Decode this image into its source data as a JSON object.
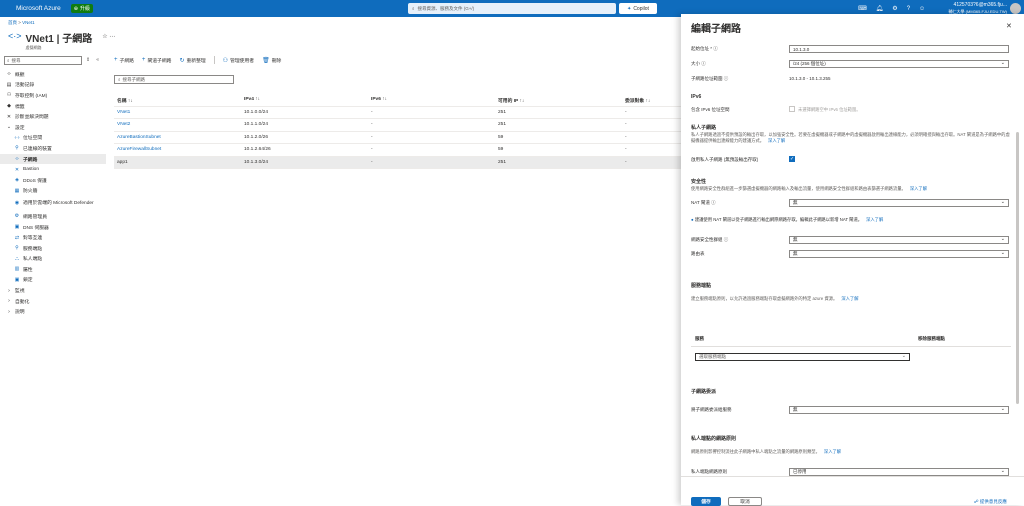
{
  "topbar": {
    "brand": "Microsoft Azure",
    "upgrade": "升級",
    "search_placeholder": "搜尋資源、服務及文件 (G+/)",
    "copilot": "Copilot",
    "account_name": "4125703?6@m365.fju...",
    "account_tenant": "輔仁大學 (MM365.FJU.EDU.TW)"
  },
  "breadcrumb": [
    "首頁",
    "VNet1"
  ],
  "page": {
    "title": "VNet1 | 子網路",
    "subtitle": "虛擬網路"
  },
  "sidebar": {
    "search_placeholder": "搜尋",
    "items": [
      {
        "label": "概觀",
        "icon": "overview-icon",
        "level": 0
      },
      {
        "label": "活動記錄",
        "icon": "activity-log-icon",
        "level": 0
      },
      {
        "label": "存取控制 (IAM)",
        "icon": "iam-icon",
        "level": 0
      },
      {
        "label": "標籤",
        "icon": "tag-icon",
        "level": 0
      },
      {
        "label": "診斷並解決問題",
        "icon": "diagnose-icon",
        "level": 0
      },
      {
        "label": "設定",
        "icon": "chevron-down-icon",
        "level": 0
      },
      {
        "label": "位址空間",
        "icon": "address-space-icon",
        "level": 1
      },
      {
        "label": "已連線的裝置",
        "icon": "devices-icon",
        "level": 1
      },
      {
        "label": "子網路",
        "icon": "subnet-icon",
        "level": 1,
        "active": true
      },
      {
        "label": "Bastion",
        "icon": "bastion-icon",
        "level": 1
      },
      {
        "label": "DDoS 保護",
        "icon": "ddos-icon",
        "level": 1
      },
      {
        "label": "防火牆",
        "icon": "firewall-icon",
        "level": 1
      },
      {
        "label": "適用於雲端的 Microsoft Defender",
        "icon": "defender-icon",
        "level": 1,
        "tall": true
      },
      {
        "label": "網路管理員",
        "icon": "network-manager-icon",
        "level": 1
      },
      {
        "label": "DNS 伺服器",
        "icon": "dns-icon",
        "level": 1
      },
      {
        "label": "對等互連",
        "icon": "peering-icon",
        "level": 1
      },
      {
        "label": "服務端點",
        "icon": "service-endpoint-icon",
        "level": 1
      },
      {
        "label": "私人端點",
        "icon": "private-endpoint-icon",
        "level": 1
      },
      {
        "label": "屬性",
        "icon": "properties-icon",
        "level": 1
      },
      {
        "label": "鎖定",
        "icon": "lock-icon",
        "level": 1
      },
      {
        "label": "監視",
        "icon": "chevron-right-icon",
        "level": 0
      },
      {
        "label": "自動化",
        "icon": "chevron-right-icon",
        "level": 0
      },
      {
        "label": "說明",
        "icon": "chevron-right-icon",
        "level": 0
      }
    ]
  },
  "toolbar": {
    "add_subnet": "子網路",
    "add_gateway_subnet": "閘道子網路",
    "refresh": "重新整理",
    "manage_users": "管理使用者",
    "delete": "刪除"
  },
  "filter_placeholder": "搜尋子網路",
  "table": {
    "headers": [
      "名稱 ↑↓",
      "IPv4 ↑↓",
      "IPv6 ↑↓",
      "可用的 IP ↑↓",
      "委派對象 ↑↓"
    ],
    "rows": [
      [
        "VNet1",
        "10.1.0.0/24",
        "-",
        "251",
        "-"
      ],
      [
        "VNet2",
        "10.1.1.0/24",
        "-",
        "251",
        "-"
      ],
      [
        "AzureBastionSubnet",
        "10.1.2.0/26",
        "-",
        "59",
        "-"
      ],
      [
        "AzureFirewallSubnet",
        "10.1.2.64/26",
        "-",
        "59",
        "-"
      ],
      [
        "app1",
        "10.1.3.0/24",
        "-",
        "251",
        "-"
      ]
    ],
    "selected_row": 4
  },
  "panel": {
    "title": "編輯子網路",
    "start_address_label": "起始位址 *",
    "start_address_value": "10.1.3.0",
    "size_label": "大小",
    "size_value": "/24 (256 個位址)",
    "range_label": "子網路位址範圍",
    "range_value": "10.1.3.0 - 10.1.3.255",
    "ipv6_title": "IPv6",
    "ipv6_label": "包含 IPv6 位址空間",
    "ipv6_checkbox_label": "未選擇網路空中 IPv6 位址範圍。",
    "private_title": "私人子網路",
    "private_desc": "私人子網路透過不提供預設的輸出存取，以加強安全性。若要在虛擬機器或子網路中的虛擬機器啟用輸出連線能力，必須明確授與輸出存取。NAT 閘道是為子網路中的虛擬機器提供輸出連線能力的建議方式。",
    "learn_more": "深入了解",
    "enable_private_label": "啟用私人子網路 (無預設輸出存取)",
    "security_title": "安全性",
    "security_desc": "使用網路安全性群組進一步篩選虛擬機器的網路輸入及輸出流量，使用網路安全性群組和路由表篩選子網路流量。",
    "nat_label": "NAT 閘道",
    "nat_value": "無",
    "nat_info": "建議使用 NAT 閘道以從子網路進行輸出網際網路存取。編輯此子網路以新增 NAT 閘道。",
    "nsg_label": "網路安全性群組",
    "nsg_value": "無",
    "route_label": "路由表",
    "route_value": "無",
    "se_title": "服務端點",
    "se_desc": "建立服務端點原則，以允許透過服務端點存取虛擬網路外的特定 azure 資源。",
    "se_col_service": "服務",
    "se_col_status": "移除服務端點",
    "se_select_placeholder": "選取服務端點",
    "delegation_title": "子網路委派",
    "delegation_label": "將子網路委派給服務",
    "delegation_value": "無",
    "pe_title": "私人端點的網路原則",
    "pe_desc": "網路原則影響控制流往此子網路中私人端點之流量的網路原則類型。",
    "pe_label": "私人端點網路原則",
    "pe_value": "已停用",
    "save": "儲存",
    "cancel": "取消",
    "feedback": "提供意見反應"
  }
}
